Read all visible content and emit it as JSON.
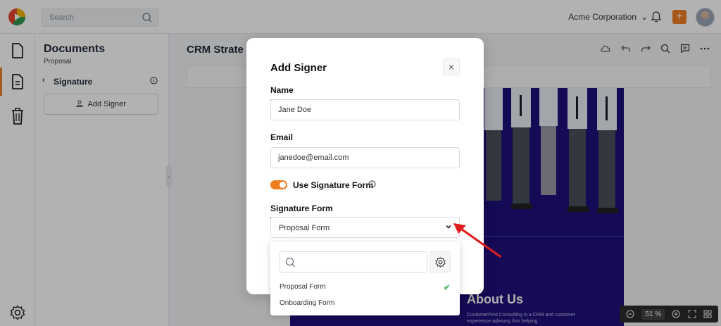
{
  "topbar": {
    "search_placeholder": "Search",
    "company": "Acme Corporation",
    "company_caret": "⌄",
    "add_button": "+"
  },
  "documents_panel": {
    "title": "Documents",
    "subtitle": "Proposal",
    "back_chevron": "‹",
    "section": "Signature",
    "add_signer_button": "Add Signer"
  },
  "canvas": {
    "document_title": "CRM Strate",
    "about_heading": "About Us",
    "about_text": "CustomerFirst Consulting is a CRM and customer experience advisory firm helping",
    "zoom_value": "51 %"
  },
  "modal": {
    "title": "Add Signer",
    "close": "×",
    "name_label": "Name",
    "name_value": "Jane Doe",
    "email_label": "Email",
    "email_value": "janedoe@email.com",
    "toggle_label": "Use Signature Form",
    "toggle_on": true,
    "signature_form_label": "Signature Form",
    "signature_form_value": "Proposal Form"
  },
  "dropdown": {
    "options": [
      {
        "label": "Proposal Form",
        "selected": true
      },
      {
        "label": "Onboarding Form",
        "selected": false
      }
    ],
    "check": "✔"
  },
  "colors": {
    "accent": "#ef7d22",
    "page_background": "#1e0f7a",
    "annotation_arrow": "#e11d1d",
    "check": "#3fae5a"
  },
  "icons": [
    "app-logo-icon",
    "search-icon",
    "bell-icon",
    "plus-icon",
    "file-icon",
    "document-icon",
    "trash-icon",
    "settings-icon",
    "info-icon",
    "user-icon",
    "cloud-icon",
    "undo-icon",
    "redo-icon",
    "comment-icon",
    "more-icon",
    "zoom-out-icon",
    "zoom-in-icon",
    "fullscreen-icon",
    "grid-icon",
    "chevron-down-icon",
    "gear-icon",
    "check-icon",
    "red-arrow-icon"
  ]
}
